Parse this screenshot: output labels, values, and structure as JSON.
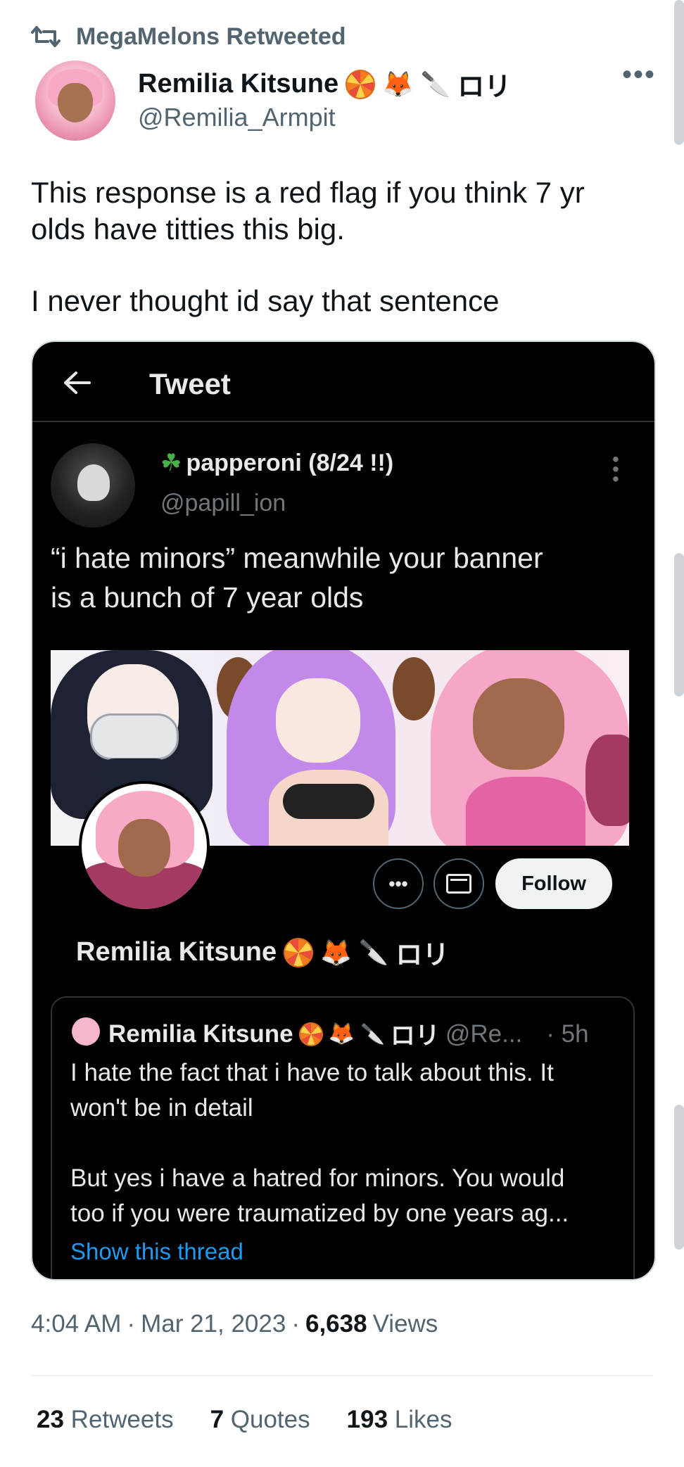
{
  "retweet_header": {
    "label": "MegaMelons Retweeted"
  },
  "author": {
    "name": "Remilia Kitsune",
    "name_suffix": "ロリ",
    "handle": "@Remilia_Armpit"
  },
  "tweet": {
    "lines": [
      "This response is a red flag if you think 7 yr",
      "olds have titties this big.",
      "I never thought id say that sentence"
    ]
  },
  "embedded": {
    "header_title": "Tweet",
    "reply": {
      "name": "papperoni (8/24 !!)",
      "handle": "@papill_ion",
      "lines": [
        "“i hate minors” meanwhile your banner",
        "is a bunch of 7 year olds"
      ]
    },
    "profile": {
      "follow_label": "Follow",
      "name": "Remilia Kitsune",
      "name_suffix": "ロリ"
    },
    "quoted": {
      "name": "Remilia Kitsune",
      "name_suffix": "ロリ",
      "handle": "@Re...",
      "time": "· 5h",
      "lines": [
        "I hate the fact that i have to talk about this. It",
        "won't be in detail",
        "But yes i have a hatred for minors. You would",
        "too if you were traumatized by one years ag..."
      ],
      "show_thread": "Show this thread"
    }
  },
  "meta": {
    "time": "4:04 AM",
    "sep1": "·",
    "date": "Mar 21, 2023",
    "sep2": "·",
    "views_count": "6,638",
    "views_label": "Views"
  },
  "stats": {
    "retweets_count": "23",
    "retweets_label": "Retweets",
    "quotes_count": "7",
    "quotes_label": "Quotes",
    "likes_count": "193",
    "likes_label": "Likes"
  },
  "colors": {
    "secondary_text": "#536471",
    "link_blue": "#1d9bf0",
    "embed_bg": "#000000"
  }
}
